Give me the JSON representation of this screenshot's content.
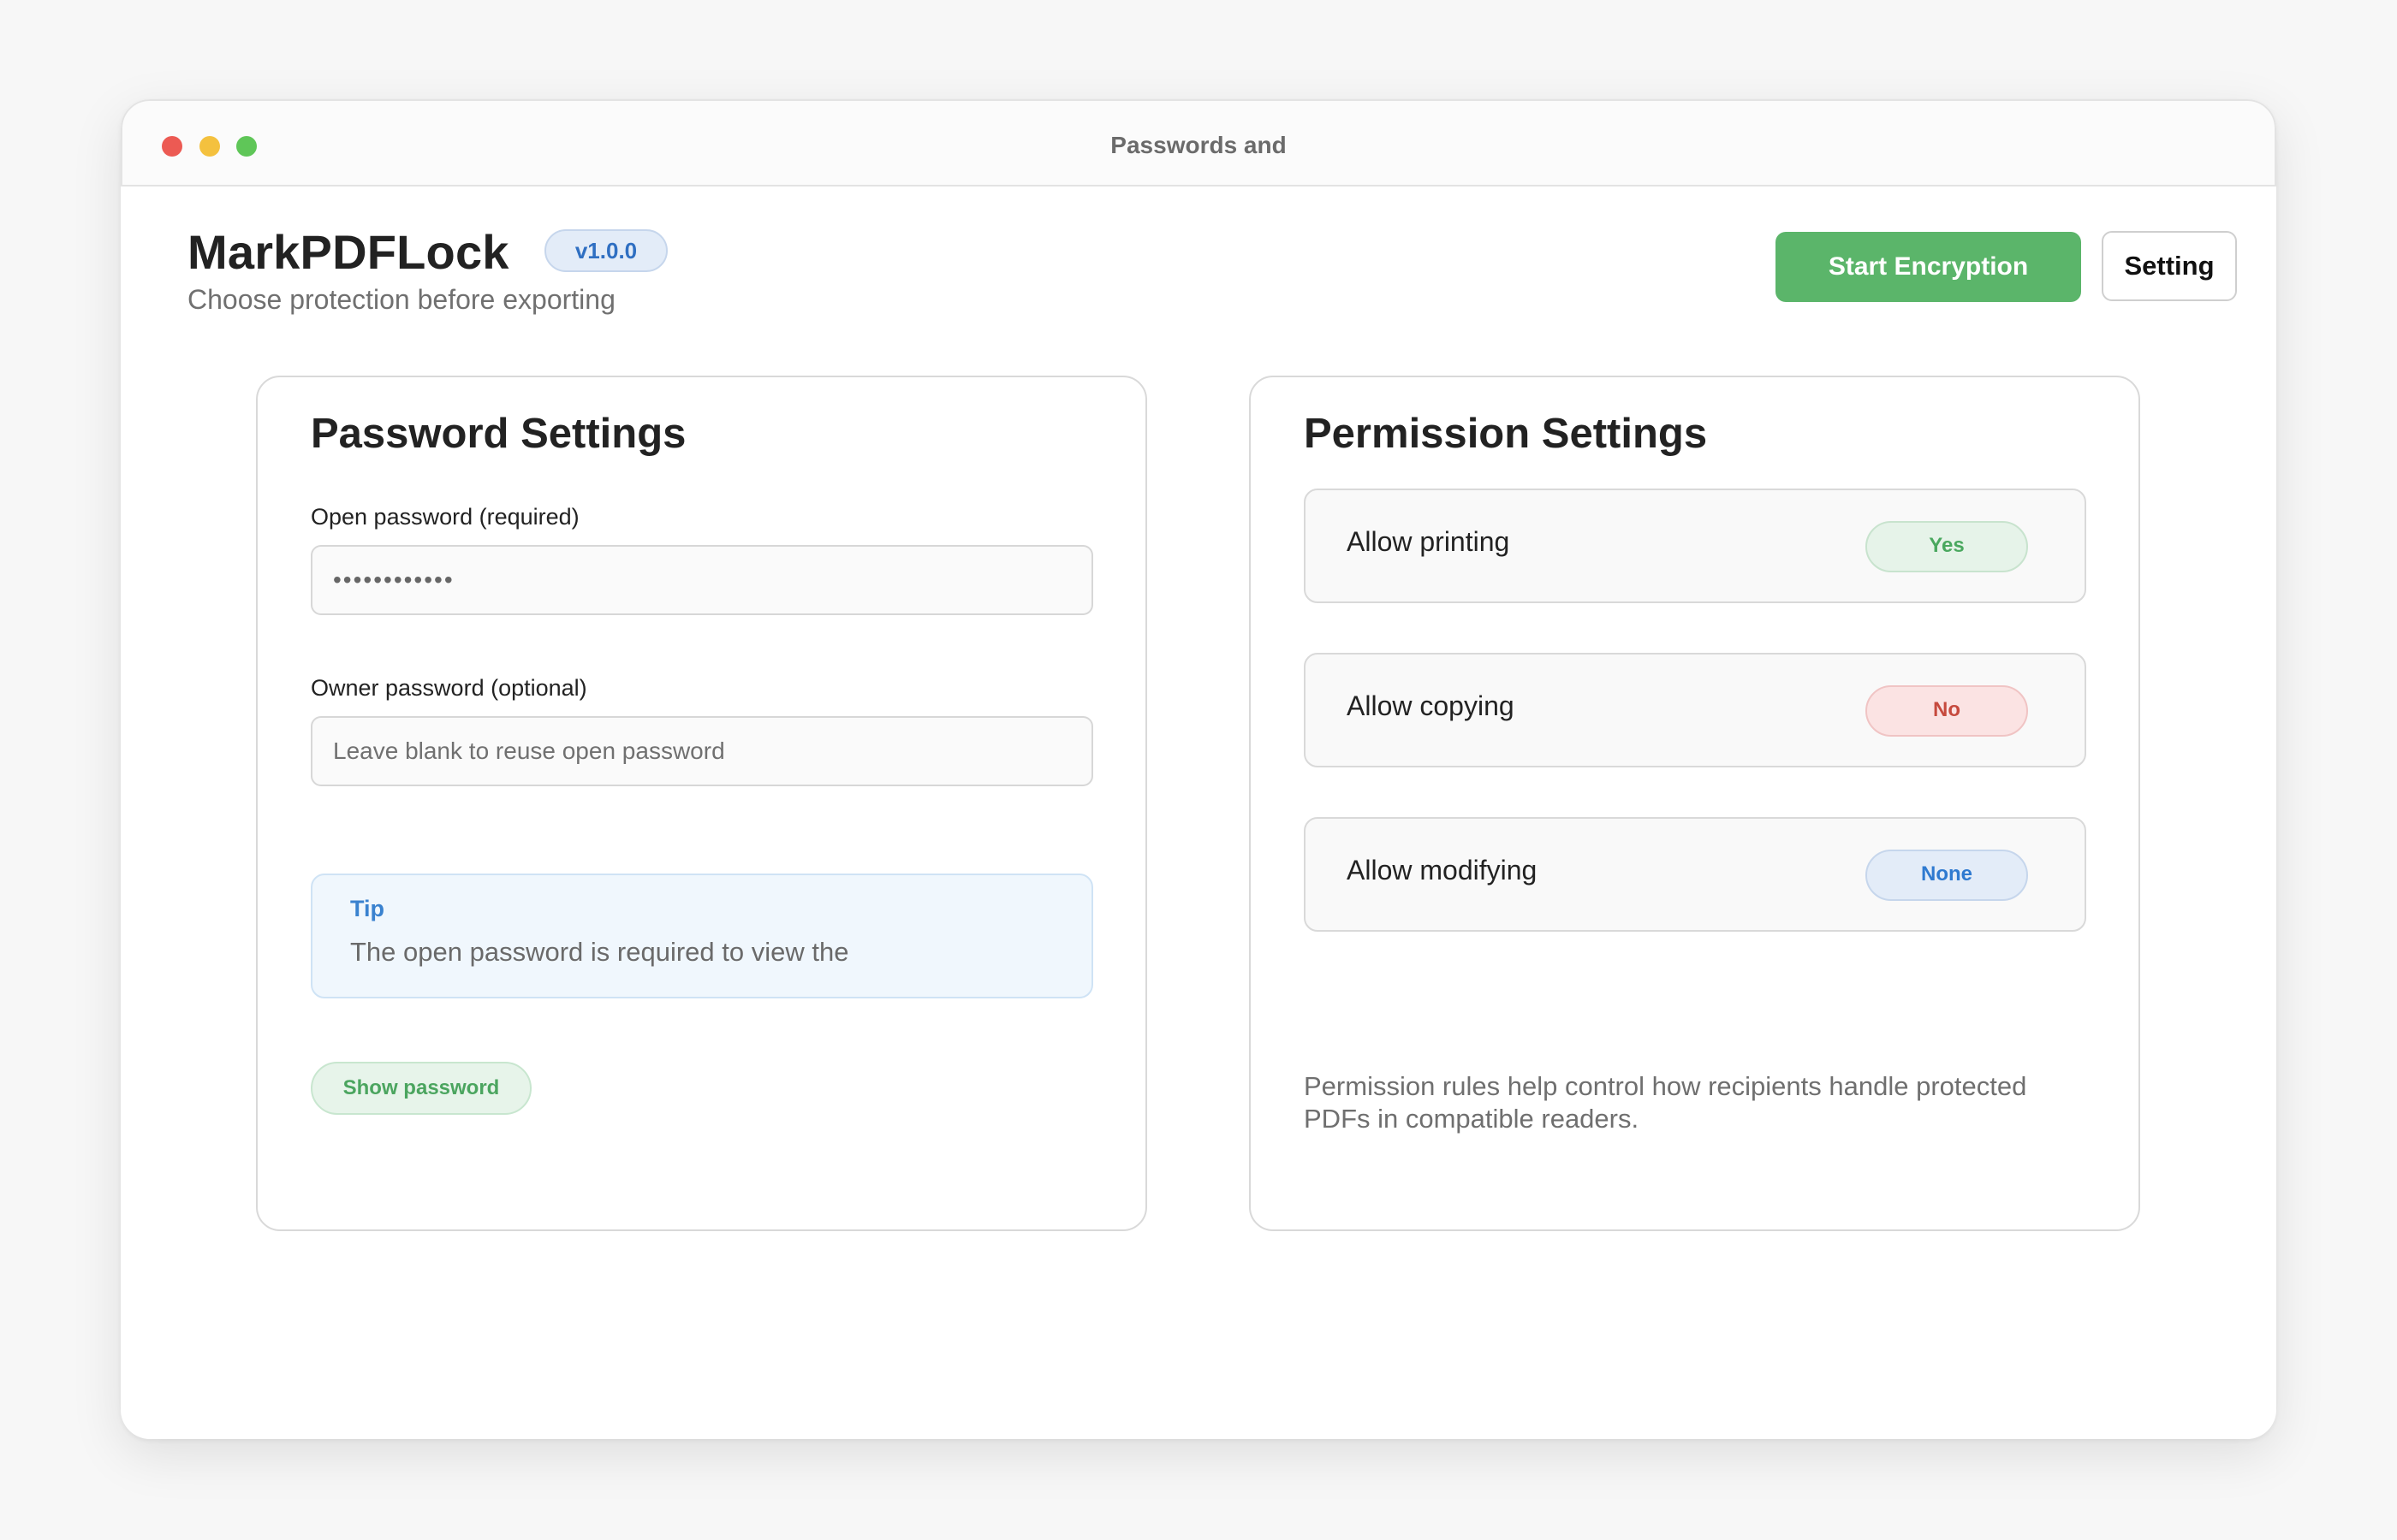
{
  "window": {
    "title": "Passwords and"
  },
  "header": {
    "app_title": "MarkPDFLock",
    "version": "v1.0.0",
    "subtitle": "Choose protection before exporting",
    "start_button": "Start Encryption",
    "settings_button": "Setting"
  },
  "password_settings": {
    "title": "Password Settings",
    "open_password": {
      "label": "Open password (required)",
      "value": "••••••••••••"
    },
    "owner_password": {
      "label": "Owner password (optional)",
      "value": "",
      "placeholder": "Leave blank to reuse open password"
    },
    "tip": {
      "title": "Tip",
      "text": "The open password is required to view the"
    },
    "show_password_button": "Show password"
  },
  "permission_settings": {
    "title": "Permission Settings",
    "items": [
      {
        "label": "Allow printing",
        "value": "Yes",
        "status": "yes"
      },
      {
        "label": "Allow copying",
        "value": "No",
        "status": "no"
      },
      {
        "label": "Allow modifying",
        "value": "None",
        "status": "none"
      }
    ],
    "note": "Permission rules help control how recipients handle protected PDFs in compatible readers."
  },
  "colors": {
    "accent_green": "#5bb56a",
    "yes_green": "#4aa85f",
    "no_red": "#c64a3e",
    "none_blue": "#2f7ad0"
  },
  "icons": {
    "close": "close-dot-icon",
    "minimize": "minimize-dot-icon",
    "zoom": "zoom-dot-icon"
  }
}
